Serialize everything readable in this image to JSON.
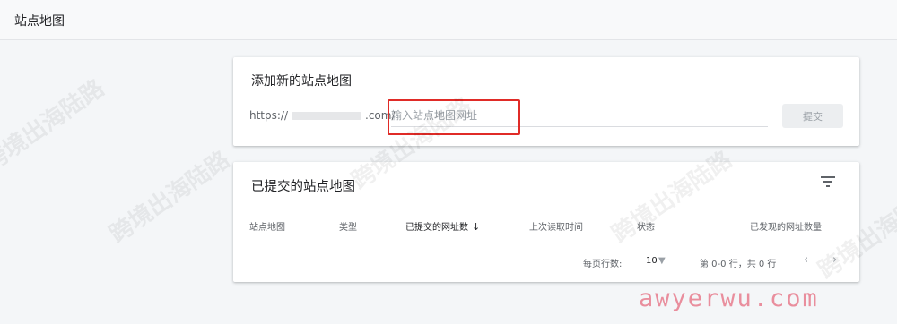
{
  "page": {
    "title": "站点地图"
  },
  "add_card": {
    "title": "添加新的站点地图",
    "url_prefix_start": "https://",
    "url_prefix_end": ".com/",
    "input_placeholder": "输入站点地图网址",
    "input_value": "",
    "submit_label": "提交"
  },
  "submitted_card": {
    "title": "已提交的站点地图",
    "columns": [
      "站点地图",
      "类型",
      "已提交的网址数",
      "上次读取时间",
      "状态",
      "已发现的网址数量"
    ],
    "sorted_column_index": 2,
    "pager": {
      "rows_per_page_label": "每页行数:",
      "rows_per_page_value": "10",
      "range_text": "第 0-0 行，共 0 行"
    }
  },
  "watermark": {
    "text": "跨境出海陆路",
    "brand": "awyerwu.com"
  },
  "colors": {
    "highlight": "#e02b27",
    "brand": "#e98e9d"
  },
  "icons": {
    "filter": "filter-icon",
    "sort": "arrow-down-icon",
    "prev": "chevron-left-icon",
    "next": "chevron-right-icon",
    "dropdown": "caret-down-icon"
  }
}
